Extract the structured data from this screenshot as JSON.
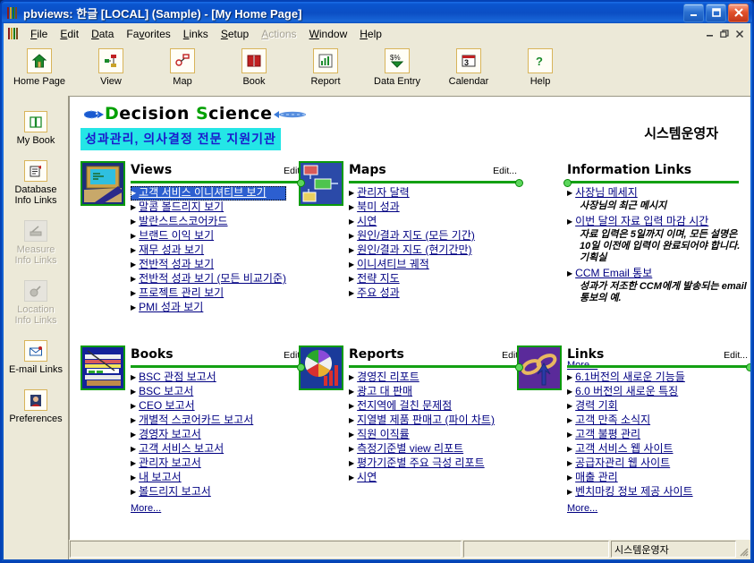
{
  "window": {
    "title": "pbviews: 한글 [LOCAL] (Sample) - [My Home Page]",
    "minimize_label": "_",
    "maximize_label": "□",
    "close_label": "✕",
    "mdi_minimize_label": "_",
    "mdi_restore_label": "❐",
    "mdi_close_label": "✕"
  },
  "menubar": {
    "items": [
      {
        "label": "File",
        "mnemonic": "F",
        "disabled": false
      },
      {
        "label": "Edit",
        "mnemonic": "E",
        "disabled": false
      },
      {
        "label": "Data",
        "mnemonic": "D",
        "disabled": false
      },
      {
        "label": "Favorites",
        "mnemonic": "v",
        "disabled": false
      },
      {
        "label": "Links",
        "mnemonic": "L",
        "disabled": false
      },
      {
        "label": "Setup",
        "mnemonic": "S",
        "disabled": false
      },
      {
        "label": "Actions",
        "mnemonic": "A",
        "disabled": true
      },
      {
        "label": "Window",
        "mnemonic": "W",
        "disabled": false
      },
      {
        "label": "Help",
        "mnemonic": "H",
        "disabled": false
      }
    ]
  },
  "toolbar": {
    "items": [
      {
        "label": "Home Page",
        "icon": "home-icon"
      },
      {
        "label": "View",
        "icon": "view-icon"
      },
      {
        "label": "Map",
        "icon": "map-icon"
      },
      {
        "label": "Book",
        "icon": "book-icon"
      },
      {
        "label": "Report",
        "icon": "report-icon"
      },
      {
        "label": "Data Entry",
        "icon": "data-entry-icon"
      },
      {
        "label": "Calendar",
        "icon": "calendar-icon"
      },
      {
        "label": "Help",
        "icon": "help-icon"
      }
    ]
  },
  "sidebar": {
    "items": [
      {
        "label": "My Book",
        "icon": "book-open-icon",
        "disabled": false
      },
      {
        "label": "Database\nInfo Links",
        "icon": "database-icon",
        "disabled": false
      },
      {
        "label": "Measure\nInfo Links",
        "icon": "measure-icon",
        "disabled": true
      },
      {
        "label": "Location\nInfo Links",
        "icon": "location-icon",
        "disabled": true
      },
      {
        "label": "E-mail Links",
        "icon": "email-icon",
        "disabled": false
      },
      {
        "label": "Preferences",
        "icon": "preferences-icon",
        "disabled": false
      }
    ]
  },
  "page": {
    "brand_part1": "Decision",
    "brand_part2": "Science",
    "brand_sub": "성과관리, 의사결정 전문 지원기관",
    "org_name": "시스템운영자",
    "edit_label": "Edit...",
    "more_label": "More..."
  },
  "panels": {
    "views": {
      "title": "Views",
      "edit": "Edit...",
      "icon": "computer-monitor-icon",
      "items": [
        {
          "label": "고객 서비스 이니셔티브 보기",
          "selected": true
        },
        {
          "label": "말콤 볼드리지 보기",
          "selected": false
        },
        {
          "label": "발란스트스코어카드",
          "selected": false
        },
        {
          "label": "브랜드 이익 보기",
          "selected": false
        },
        {
          "label": "재무 성과 보기",
          "selected": false
        },
        {
          "label": "전반적 성과 보기",
          "selected": false
        },
        {
          "label": "전반적 성과 보기 (모든 비교기준)",
          "selected": false
        },
        {
          "label": "프로젝트 관리 보기",
          "selected": false
        },
        {
          "label": "PMI 성과 보기",
          "selected": false
        }
      ]
    },
    "maps": {
      "title": "Maps",
      "edit": "Edit...",
      "icon": "flowchart-icon",
      "items": [
        {
          "label": "관리자 달력"
        },
        {
          "label": "북미 성과"
        },
        {
          "label": "시연"
        },
        {
          "label": "원인/결과 지도 (모든 기간)"
        },
        {
          "label": "원인/결과 지도 (현기간만)"
        },
        {
          "label": "이니셔티브 궤적"
        },
        {
          "label": "전략 지도"
        },
        {
          "label": "주요 성과"
        }
      ]
    },
    "information_links": {
      "title": "Information Links",
      "more": "More...",
      "items": [
        {
          "label": "사장님 메세지",
          "desc": "사장님의 최근 메시지"
        },
        {
          "label": "이번 달의 자료 입력 마감 시간",
          "desc": "자료 입력은 5일까지 이며, 모든 설명은 10일 이전에 입력이 완료되어야 합니다. 기획실"
        },
        {
          "label": "CCM Email 통보",
          "desc": "성과가 저조한 CCM에게 발송되는 email 통보의 예."
        }
      ]
    },
    "books": {
      "title": "Books",
      "edit": "Edit...",
      "more": "More...",
      "icon": "books-stack-icon",
      "items": [
        {
          "label": "BSC 관점 보고서"
        },
        {
          "label": "BSC 보고서"
        },
        {
          "label": "CEO 보고서"
        },
        {
          "label": "개별적 스코어카드 보고서"
        },
        {
          "label": "경영자 보고서"
        },
        {
          "label": "고객 서비스 보고서"
        },
        {
          "label": "관리자 보고서"
        },
        {
          "label": "내 보고서"
        },
        {
          "label": "볼드리지 보고서"
        }
      ]
    },
    "reports": {
      "title": "Reports",
      "edit": "Edit...",
      "icon": "pie-bar-chart-icon",
      "items": [
        {
          "label": "경영진 리포트"
        },
        {
          "label": "광고 대 판매"
        },
        {
          "label": "전지역에 걸친 문제점"
        },
        {
          "label": "지열별 제품 판매고 (파이 차트)"
        },
        {
          "label": "직원 이직률"
        },
        {
          "label": "측정기준별 view 리포트"
        },
        {
          "label": "평가기준별 주요 극성 리포트"
        },
        {
          "label": "시연"
        }
      ]
    },
    "links": {
      "title": "Links",
      "edit": "Edit...",
      "more": "More...",
      "icon": "chain-link-icon",
      "items": [
        {
          "label": "6.1버전의 새로운 기능들"
        },
        {
          "label": "6.0 버전의 새로운 특징"
        },
        {
          "label": "경력 기회"
        },
        {
          "label": "고객 만족 소식지"
        },
        {
          "label": "고객 불평 관리"
        },
        {
          "label": "고객 서비스 웹 사이트"
        },
        {
          "label": "공급자관리 웹 사이트"
        },
        {
          "label": "매출 관리"
        },
        {
          "label": "벤치마킹 정보 제공 사이트"
        }
      ]
    }
  },
  "statusbar": {
    "panel1": "",
    "panel2": "",
    "panel3": "시스템운영자"
  },
  "colors": {
    "titlebar_blue": "#0b4ec4",
    "accent_green": "#13a013",
    "link_blue": "#000082",
    "selection_blue": "#2c5fd0",
    "highlight_cyan": "#24e6e6",
    "chrome": "#ece9d8"
  }
}
